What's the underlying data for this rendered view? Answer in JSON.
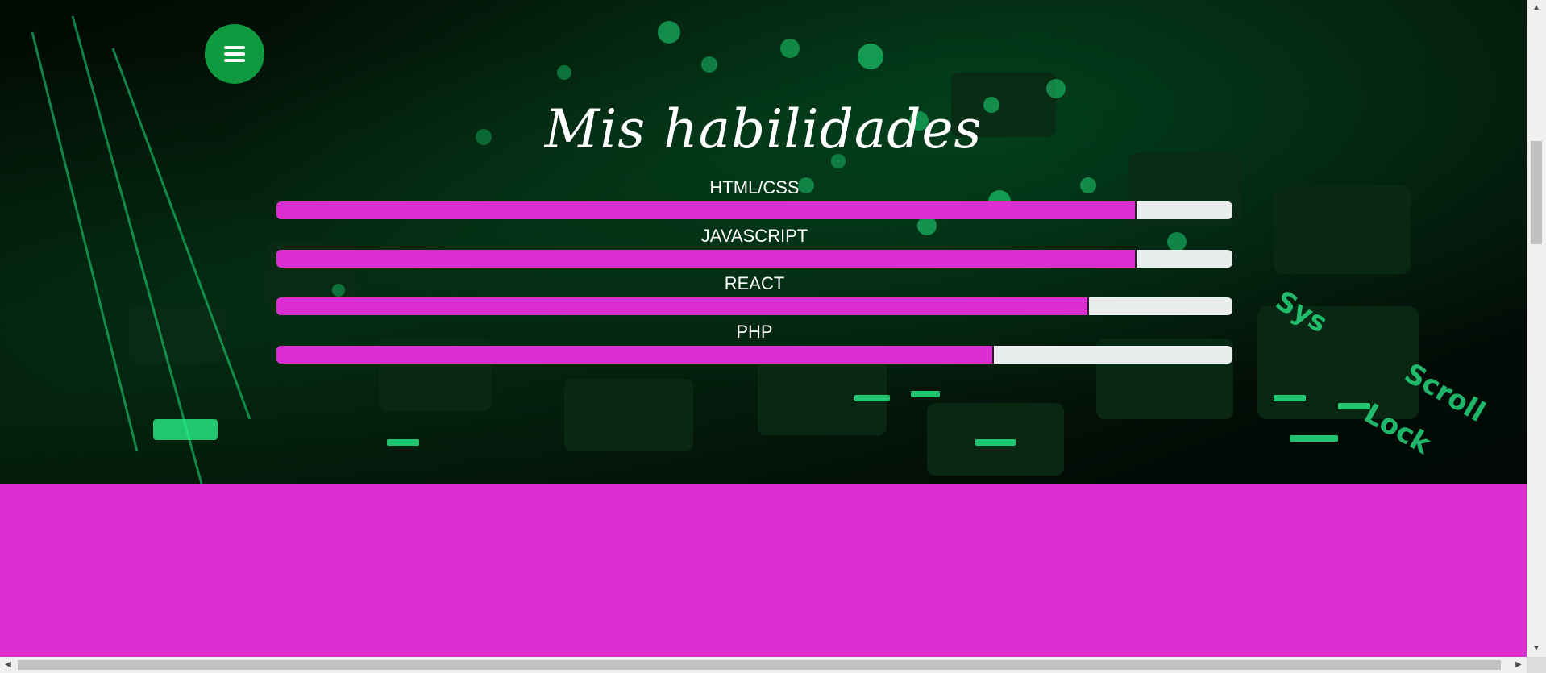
{
  "colors": {
    "accent": "#db2ed0",
    "menu_button": "#0f9a40",
    "track": "#e8ecec",
    "hero_glow": "#1fe07a"
  },
  "menu_button": {
    "icon": "hamburger-menu-icon"
  },
  "section": {
    "title": "Mis habilidades"
  },
  "skills": [
    {
      "label": "HTML/CSS",
      "level_percent": 90
    },
    {
      "label": "JAVASCRIPT",
      "level_percent": 90
    },
    {
      "label": "REACT",
      "level_percent": 85
    },
    {
      "label": "PHP",
      "level_percent": 75
    }
  ],
  "scrollbars": {
    "up_arrow": "▲",
    "down_arrow": "▼",
    "left_arrow": "◀",
    "right_arrow": "▶"
  }
}
